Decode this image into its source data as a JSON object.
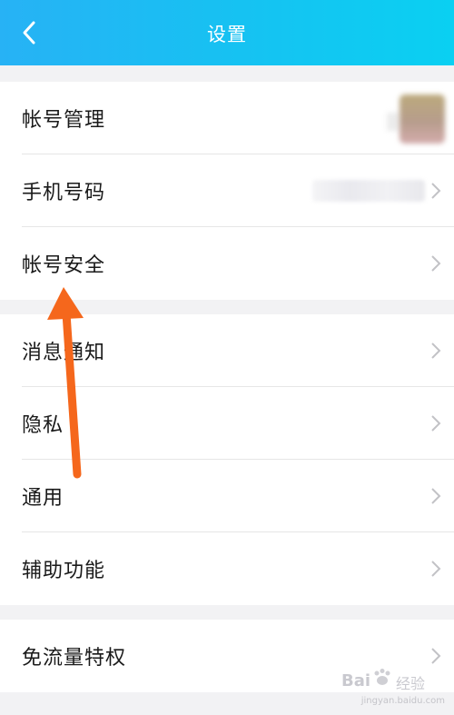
{
  "header": {
    "title": "设置",
    "back_icon": "chevron-left-icon"
  },
  "groups": [
    {
      "items": [
        {
          "label": "帐号管理",
          "right": "avatar"
        },
        {
          "label": "手机号码",
          "right": "masked-phone"
        },
        {
          "label": "帐号安全"
        }
      ]
    },
    {
      "items": [
        {
          "label": "消息通知"
        },
        {
          "label": "隐私"
        },
        {
          "label": "通用"
        },
        {
          "label": "辅助功能"
        }
      ]
    },
    {
      "items": [
        {
          "label": "免流量特权"
        }
      ]
    }
  ],
  "annotation": {
    "icon": "arrow-up-icon",
    "color": "#f5671c"
  },
  "watermark": {
    "brand": "Bai",
    "brand_suffix": "经验",
    "url": "jingyan.baidu.com"
  },
  "colors": {
    "header_start": "#27b2f5",
    "header_end": "#0ad0f2",
    "background": "#f2f2f4",
    "chevron": "#c2c2c6"
  }
}
